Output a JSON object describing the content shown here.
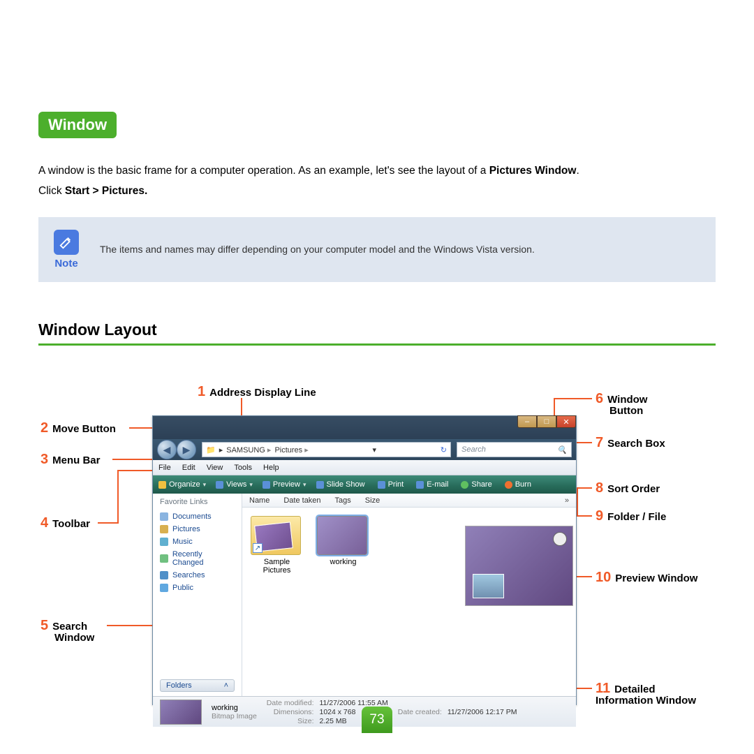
{
  "heading": "Window",
  "intro_prefix": "A window is the basic frame for a computer operation. As an example, let's see the layout of a ",
  "intro_bold": "Pictures Window",
  "intro_suffix": ".",
  "click_prefix": "Click ",
  "click_bold": "Start > Pictures.",
  "note": {
    "label": "Note",
    "text": "The items and names may differ depending on your computer model and the Windows Vista version."
  },
  "section_title": "Window Layout",
  "callouts": {
    "c1": {
      "num": "1",
      "label": "Address Display Line"
    },
    "c2": {
      "num": "2",
      "label": "Move Button"
    },
    "c3": {
      "num": "3",
      "label": "Menu Bar"
    },
    "c4": {
      "num": "4",
      "label": "Toolbar"
    },
    "c5a": {
      "num": "5",
      "label": "Search"
    },
    "c5b": {
      "label": "Window"
    },
    "c6a": {
      "num": "6",
      "label": "Window"
    },
    "c6b": {
      "label": "Button"
    },
    "c7": {
      "num": "7",
      "label": "Search Box"
    },
    "c8": {
      "num": "8",
      "label": "Sort Order"
    },
    "c9": {
      "num": "9",
      "label": "Folder / File"
    },
    "c10": {
      "num": "10",
      "label": "Preview Window"
    },
    "c11a": {
      "num": "11",
      "label": "Detailed"
    },
    "c11b": {
      "label": "Information Window"
    }
  },
  "vista": {
    "breadcrumb": [
      "SAMSUNG",
      "Pictures"
    ],
    "search_placeholder": "Search",
    "menu": [
      "File",
      "Edit",
      "View",
      "Tools",
      "Help"
    ],
    "toolbar": [
      "Organize",
      "Views",
      "Preview",
      "Slide Show",
      "Print",
      "E-mail",
      "Share",
      "Burn"
    ],
    "favorites_title": "Favorite Links",
    "favorites": [
      "Documents",
      "Pictures",
      "Music",
      "Recently Changed",
      "Searches",
      "Public"
    ],
    "folders_btn": "Folders",
    "columns": [
      "Name",
      "Date taken",
      "Tags",
      "Size"
    ],
    "col_expand": "»",
    "files": [
      "Sample Pictures",
      "working"
    ],
    "details": {
      "name": "working",
      "type": "Bitmap Image",
      "labels": {
        "modified": "Date modified:",
        "dimensions": "Dimensions:",
        "size": "Size:",
        "created": "Date created:"
      },
      "modified": "11/27/2006 11:55 AM",
      "dimensions": "1024 x 768",
      "size": "2.25 MB",
      "created": "11/27/2006 12:17 PM"
    }
  },
  "page_number": "73"
}
